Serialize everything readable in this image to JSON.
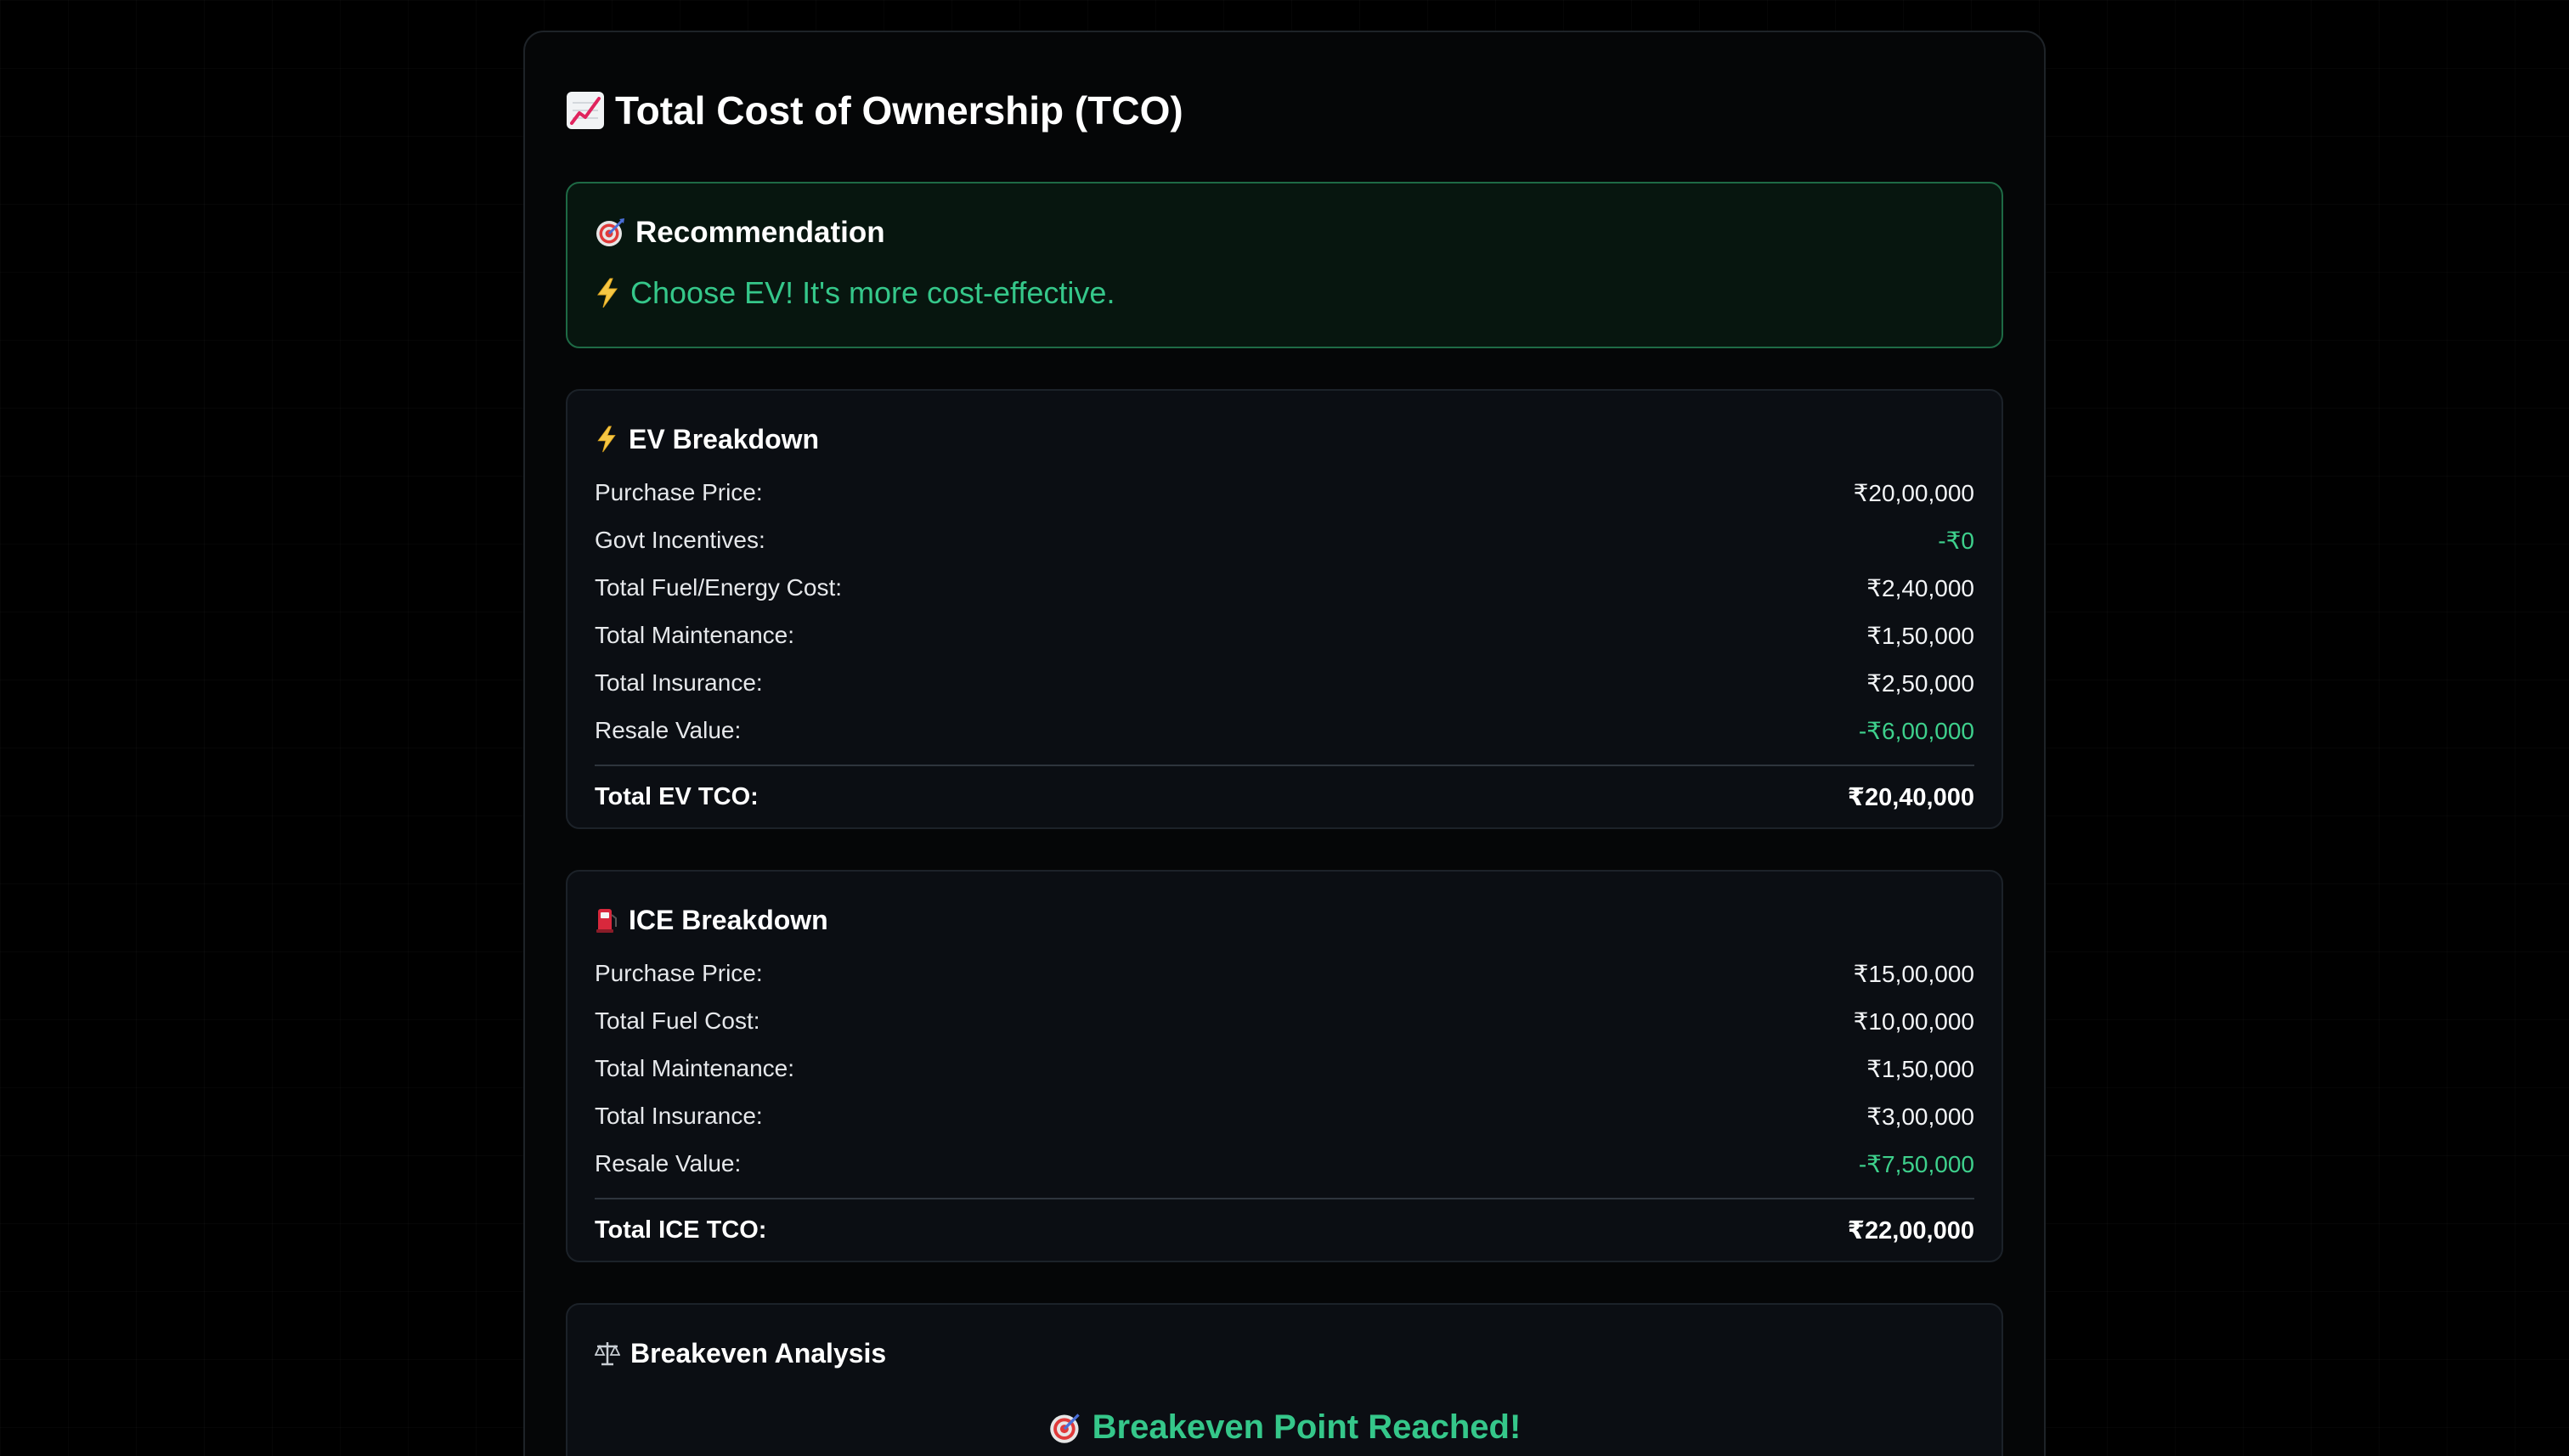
{
  "header": {
    "icon": "chart-increasing-icon",
    "title": "Total Cost of Ownership (TCO)"
  },
  "recommendation": {
    "icon": "target-icon",
    "heading": "Recommendation",
    "message_icon": "lightning-icon",
    "message": "Choose EV! It's more cost-effective."
  },
  "ev": {
    "icon": "lightning-icon",
    "heading": "EV Breakdown",
    "rows": [
      {
        "label": "Purchase Price:",
        "value": "₹20,00,000",
        "color": "#f2f4f6"
      },
      {
        "label": "Govt Incentives:",
        "value": "-₹0",
        "color": "#3ed08c"
      },
      {
        "label": "Total Fuel/Energy Cost:",
        "value": "₹2,40,000",
        "color": "#f2f4f6"
      },
      {
        "label": "Total Maintenance:",
        "value": "₹1,50,000",
        "color": "#f2f4f6"
      },
      {
        "label": "Total Insurance:",
        "value": "₹2,50,000",
        "color": "#f2f4f6"
      },
      {
        "label": "Resale Value:",
        "value": "-₹6,00,000",
        "color": "#3ed08c"
      }
    ],
    "total_label": "Total EV TCO:",
    "total_value": "₹20,40,000"
  },
  "ice": {
    "icon": "fuel-pump-icon",
    "heading": "ICE Breakdown",
    "rows": [
      {
        "label": "Purchase Price:",
        "value": "₹15,00,000",
        "color": "#f2f4f6"
      },
      {
        "label": "Total Fuel Cost:",
        "value": "₹10,00,000",
        "color": "#f2f4f6"
      },
      {
        "label": "Total Maintenance:",
        "value": "₹1,50,000",
        "color": "#f2f4f6"
      },
      {
        "label": "Total Insurance:",
        "value": "₹3,00,000",
        "color": "#f2f4f6"
      },
      {
        "label": "Resale Value:",
        "value": "-₹7,50,000",
        "color": "#3ed08c"
      }
    ],
    "total_label": "Total ICE TCO:",
    "total_value": "₹22,00,000"
  },
  "breakeven": {
    "icon": "balance-scale-icon",
    "heading": "Breakeven Analysis",
    "message_icon": "target-icon",
    "message": "Breakeven Point Reached!"
  },
  "colors": {
    "accent_green": "#35c78a",
    "positive_value": "#3ed08c",
    "background": "#000000",
    "card": "#050607",
    "section": "#0b0e13"
  }
}
